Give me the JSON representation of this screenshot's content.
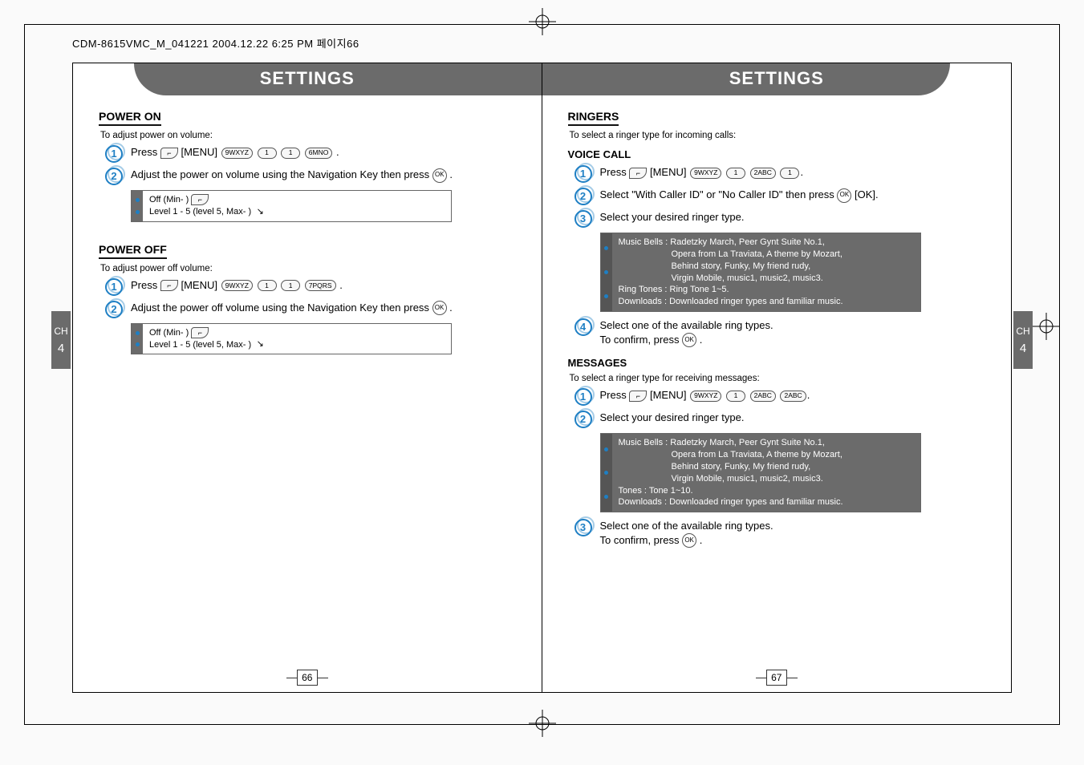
{
  "header_strip": "CDM-8615VMC_M_041221  2004.12.22 6:25 PM  페이지66",
  "chapter_label": "CH",
  "chapter_number": "4",
  "left": {
    "tab_title": "SETTINGS",
    "page_number": "66",
    "power_on": {
      "heading": "POWER ON",
      "lead": "To adjust power on volume:",
      "step1_prefix": "Press",
      "step1_menu": "[MENU]",
      "step2": "Adjust the power on volume using the Navigation Key then press",
      "info_line1": "Off (Min-        )",
      "info_line2": "Level 1 - 5 (level 5, Max-        )"
    },
    "power_off": {
      "heading": "POWER OFF",
      "lead": "To adjust power off volume:",
      "step1_prefix": "Press",
      "step1_menu": "[MENU]",
      "step2": "Adjust the power off volume using the Navigation Key then press",
      "info_line1": "Off (Min-        )",
      "info_line2": "Level 1 - 5 (level 5, Max-        )"
    }
  },
  "right": {
    "tab_title": "SETTINGS",
    "page_number": "67",
    "ringers": {
      "heading": "RINGERS",
      "lead": "To select a ringer type for incoming calls:"
    },
    "voice_call": {
      "heading": "VOICE CALL",
      "step1_prefix": "Press",
      "step1_menu": "[MENU]",
      "step2a": "Select \"With Caller ID\" or \"No Caller ID\" then press",
      "step2b": "[OK].",
      "step3": "Select your desired ringer type.",
      "info_music": "Music Bells : Radetzky March, Peer Gynt Suite No.1,",
      "info_music2": "Opera from La Traviata, A theme by Mozart,",
      "info_music3": "Behind story, Funky, My friend rudy,",
      "info_music4": "Virgin Mobile, music1, music2, music3.",
      "info_ring": "Ring Tones : Ring Tone 1~5.",
      "info_dl": "Downloads : Downloaded ringer types and familiar music.",
      "step4a": "Select one of the available ring types.",
      "step4b": "To confirm, press"
    },
    "messages": {
      "heading": "MESSAGES",
      "lead": "To select a ringer type for receiving messages:",
      "step1_prefix": "Press",
      "step1_menu": "[MENU]",
      "step2": "Select your desired ringer type.",
      "info_music": "Music Bells : Radetzky March, Peer Gynt Suite No.1,",
      "info_music2": "Opera from La Traviata, A theme by Mozart,",
      "info_music3": "Behind story, Funky, My friend rudy,",
      "info_music4": "Virgin Mobile, music1, music2, music3.",
      "info_tones": "Tones : Tone 1~10.",
      "info_dl": "Downloads : Downloaded ringer types and familiar music.",
      "step3a": "Select one of the available ring types.",
      "step3b": "To confirm, press"
    }
  },
  "keys": {
    "k9": "9WXYZ",
    "k1": "1",
    "k2": "2ABC",
    "k6": "6MNO",
    "k7": "7PQRS",
    "ok": "OK",
    "soft": "—"
  }
}
